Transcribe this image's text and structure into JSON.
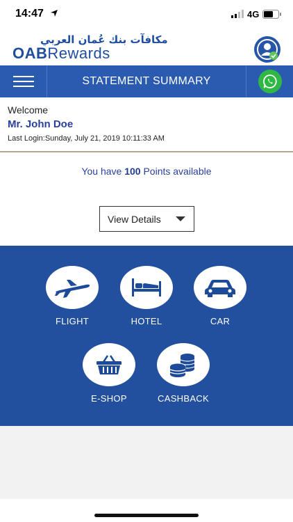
{
  "status_bar": {
    "time": "14:47",
    "network": "4G"
  },
  "brand": {
    "arabic_name": "مكافآت بنك عُمان العربي",
    "latin_oab": "OAB",
    "latin_rewards": "Rewards"
  },
  "navbar": {
    "title": "STATEMENT SUMMARY"
  },
  "welcome": {
    "label": "Welcome",
    "user_name": "Mr. John Doe",
    "last_login": "Last Login:Sunday, July 21, 2019 10:11:33 AM"
  },
  "points": {
    "prefix": "You have",
    "value": "100",
    "suffix": "Points available"
  },
  "view_details": {
    "label": "View Details"
  },
  "services": [
    {
      "label": "FLIGHT",
      "icon": "airplane-icon"
    },
    {
      "label": "HOTEL",
      "icon": "bed-icon"
    },
    {
      "label": "CAR",
      "icon": "car-icon"
    },
    {
      "label": "E-SHOP",
      "icon": "basket-icon"
    },
    {
      "label": "CASHBACK",
      "icon": "coins-icon"
    }
  ],
  "colors": {
    "primary": "#2a5bb0",
    "panel": "#23509e",
    "whatsapp": "#2fb944",
    "text_accent": "#2a3f9e"
  }
}
